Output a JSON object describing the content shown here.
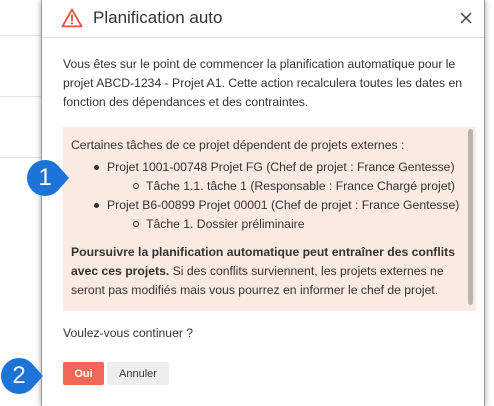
{
  "dialog": {
    "title": "Planification auto",
    "intro": "Vous êtes sur le point de commencer la planification automatique pour le projet ABCD-1234 - Projet A1. Cette action recalculera toutes les dates en fonction des dépendances et des contraintes.",
    "notice": {
      "lead": "Certaines tâches de ce projet dépendent de projets externes :",
      "projects": [
        {
          "label": "Projet 1001-00748 Projet FG (Chef de projet : France Gentesse)",
          "tasks": [
            "Tâche 1.1. tâche 1 (Responsable : France Chargé projet)"
          ]
        },
        {
          "label": "Projet B6-00899 Projet 00001 (Chef de projet : France Gentesse)",
          "tasks": [
            "Tâche 1. Dossier préliminaire"
          ]
        }
      ],
      "warning_bold": "Poursuivre la planification automatique peut entraîner des conflits avec ces projets.",
      "warning_rest": " Si des conflits surviennent, les projets externes ne seront pas modifiés mais vous pourrez en informer le chef de projet."
    },
    "question": "Voulez-vous continuer ?",
    "buttons": {
      "yes": "Oui",
      "cancel": "Annuler"
    },
    "icons": {
      "header": "warning-triangle-icon",
      "close": "close-icon"
    }
  },
  "callouts": [
    "1",
    "2"
  ],
  "colors": {
    "accent": "#f06857",
    "warning_icon": "#e0533f",
    "notice_bg": "#fbeae2",
    "callout": "#1e73d8",
    "overlay": "#6e6e6e"
  }
}
